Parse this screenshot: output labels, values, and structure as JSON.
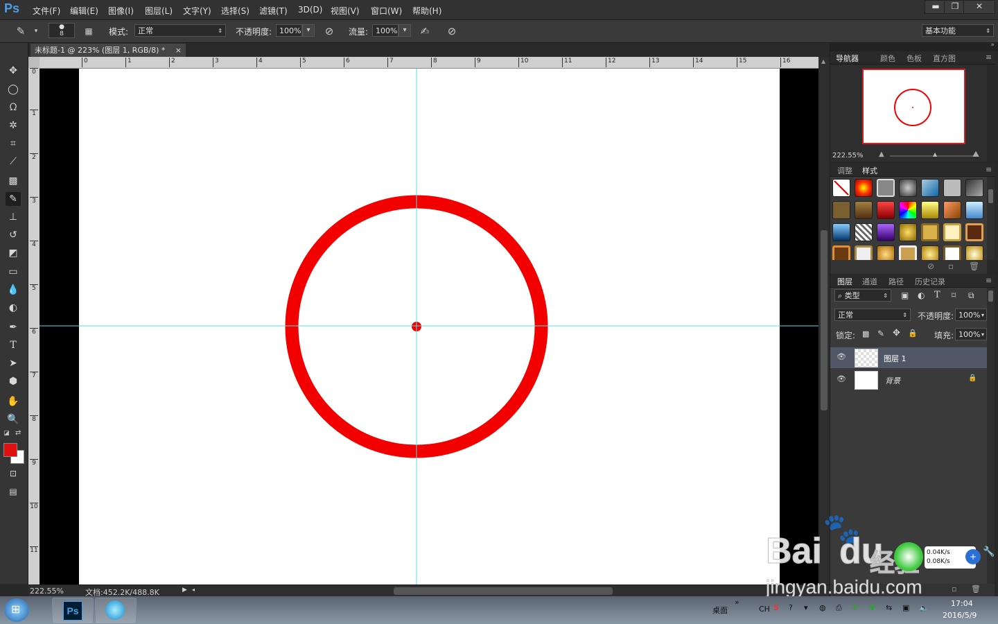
{
  "app": {
    "logo": "Ps"
  },
  "menu": [
    "文件(F)",
    "编辑(E)",
    "图像(I)",
    "图层(L)",
    "文字(Y)",
    "选择(S)",
    "滤镜(T)",
    "3D(D)",
    "视图(V)",
    "窗口(W)",
    "帮助(H)"
  ],
  "window_controls": {
    "minimize": "▬",
    "restore": "❐",
    "close": "✕"
  },
  "options": {
    "brush_size": "8",
    "mode_label": "模式:",
    "mode_value": "正常",
    "opacity_label": "不透明度:",
    "opacity_value": "100%",
    "flow_label": "流量:",
    "flow_value": "100%",
    "workspace": "基本功能"
  },
  "document": {
    "tab_title": "未标题-1 @ 223% (图层 1, RGB/8) *",
    "tab_close": "×",
    "zoom": "222.55%",
    "doc_info": "文档:452.2K/488.8K"
  },
  "ruler_top": [
    "0",
    "1",
    "2",
    "3",
    "4",
    "5",
    "6",
    "7",
    "8",
    "9",
    "10",
    "11",
    "12",
    "13",
    "14",
    "15",
    "16"
  ],
  "ruler_left": [
    "0",
    "1",
    "2",
    "3",
    "4",
    "5",
    "6",
    "7",
    "8",
    "9",
    "10",
    "11"
  ],
  "colors": {
    "foreground": "#e01010",
    "background": "#ffffff",
    "circle": "#f20000",
    "guide": "#4de0e8",
    "accent": "#4aa0e6"
  },
  "tools": [
    "move-icon",
    "marquee-icon",
    "lasso-icon",
    "magic-wand-icon",
    "crop-icon",
    "eyedropper-icon",
    "healing-icon",
    "brush-icon",
    "stamp-icon",
    "history-brush-icon",
    "eraser-icon",
    "gradient-icon",
    "blur-icon",
    "dodge-icon",
    "pen-icon",
    "type-icon",
    "path-select-icon",
    "shape-icon",
    "hand-icon",
    "zoom-icon"
  ],
  "navigator": {
    "tabs": [
      "导航器",
      "颜色",
      "色板",
      "直方图"
    ],
    "zoom": "222.55%"
  },
  "styles_panel": {
    "tabs": [
      "调整",
      "样式"
    ]
  },
  "layers_panel": {
    "tabs": [
      "图层",
      "通道",
      "路径",
      "历史记录"
    ],
    "filter_kind": "类型",
    "blend_mode": "正常",
    "opacity_label": "不透明度:",
    "opacity_value": "100%",
    "lock_label": "锁定:",
    "fill_label": "填充:",
    "fill_value": "100%",
    "layers": [
      {
        "name": "图层 1",
        "selected": true
      },
      {
        "name": "背景",
        "selected": false,
        "locked": true
      }
    ]
  },
  "taskbar": {
    "desktop_label": "桌面",
    "lang": "CH",
    "time": "17:04",
    "date": "2016/5/9",
    "net_up": "0.04K/s",
    "net_down": "0.08K/s"
  },
  "watermark": {
    "text": "Bai",
    "text2": "du",
    "text3": "经验",
    "url": "jingyan.baidu.com"
  }
}
